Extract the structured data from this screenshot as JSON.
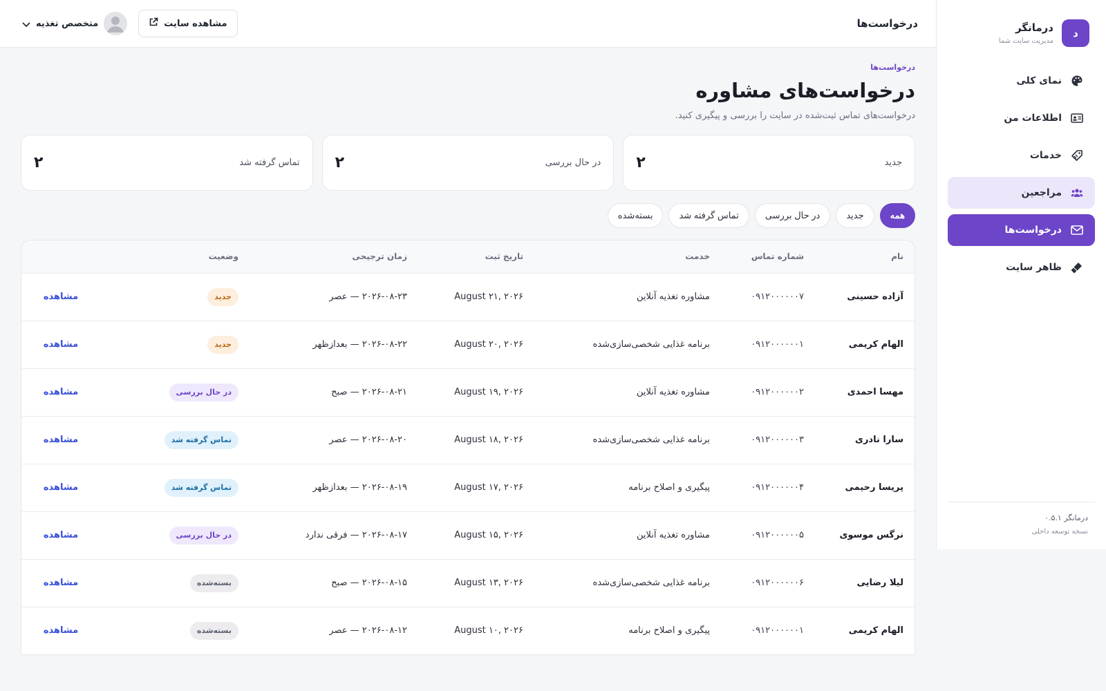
{
  "brand": {
    "logo_letter": "د",
    "name": "درمانگر",
    "subtitle": "مدیریت سایت شما"
  },
  "sidebar": {
    "items": [
      {
        "label": "نمای کلی",
        "icon": "palette-icon"
      },
      {
        "label": "اطلاعات من",
        "icon": "id-card-icon"
      },
      {
        "label": "خدمات",
        "icon": "tag-icon"
      },
      {
        "label": "مراجعین",
        "icon": "users-icon"
      },
      {
        "label": "درخواست‌ها",
        "icon": "envelope-icon"
      },
      {
        "label": "ظاهر سایت",
        "icon": "brush-icon"
      }
    ],
    "footer": {
      "version": "درمانگر ۰.۵.۱",
      "note": "نسخه توسعه داخلی"
    }
  },
  "topbar": {
    "title": "درخواست‌ها",
    "site_button": "مشاهده سایت",
    "user_name": "متخصص تغذیه"
  },
  "page": {
    "breadcrumb": "درخواست‌ها",
    "title": "درخواست‌های مشاوره",
    "description": "درخواست‌های تماس ثبت‌شده در سایت را بررسی و پیگیری کنید."
  },
  "stats": [
    {
      "label": "جدید",
      "value": "۲"
    },
    {
      "label": "در حال بررسی",
      "value": "۲"
    },
    {
      "label": "تماس گرفته شد",
      "value": "۲"
    }
  ],
  "filters": [
    "همه",
    "جدید",
    "در حال بررسی",
    "تماس گرفته شد",
    "بسته‌شده"
  ],
  "table": {
    "columns": [
      "نام",
      "شماره تماس",
      "خدمت",
      "تاریخ ثبت",
      "زمان ترجیحی",
      "وضعیت",
      ""
    ],
    "rows": [
      {
        "name": "آزاده حسینی",
        "phone": "۰۹۱۲۰۰۰۰۰۰۷",
        "service": "مشاوره تغذیه آنلاین",
        "date": "August ۲۱, ۲۰۲۶",
        "time": "۲۰۲۶-۰۸-۲۳ — عصر",
        "status": "جدید",
        "status_kind": "new",
        "action": "مشاهده"
      },
      {
        "name": "الهام کریمی",
        "phone": "۰۹۱۲۰۰۰۰۰۰۱",
        "service": "برنامه غذایی شخصی‌سازی‌شده",
        "date": "August ۲۰, ۲۰۲۶",
        "time": "۲۰۲۶-۰۸-۲۲ — بعدازظهر",
        "status": "جدید",
        "status_kind": "new",
        "action": "مشاهده"
      },
      {
        "name": "مهسا احمدی",
        "phone": "۰۹۱۲۰۰۰۰۰۰۲",
        "service": "مشاوره تغذیه آنلاین",
        "date": "August ۱۹, ۲۰۲۶",
        "time": "۲۰۲۶-۰۸-۲۱ — صبح",
        "status": "در حال بررسی",
        "status_kind": "review",
        "action": "مشاهده"
      },
      {
        "name": "سارا نادری",
        "phone": "۰۹۱۲۰۰۰۰۰۰۳",
        "service": "برنامه غذایی شخصی‌سازی‌شده",
        "date": "August ۱۸, ۲۰۲۶",
        "time": "۲۰۲۶-۰۸-۲۰ — عصر",
        "status": "تماس گرفته شد",
        "status_kind": "contacted",
        "action": "مشاهده"
      },
      {
        "name": "پریسا رحیمی",
        "phone": "۰۹۱۲۰۰۰۰۰۰۴",
        "service": "پیگیری و اصلاح برنامه",
        "date": "August ۱۷, ۲۰۲۶",
        "time": "۲۰۲۶-۰۸-۱۹ — بعدازظهر",
        "status": "تماس گرفته شد",
        "status_kind": "contacted",
        "action": "مشاهده"
      },
      {
        "name": "نرگس موسوی",
        "phone": "۰۹۱۲۰۰۰۰۰۰۵",
        "service": "مشاوره تغذیه آنلاین",
        "date": "August ۱۵, ۲۰۲۶",
        "time": "۲۰۲۶-۰۸-۱۷ — فرقی ندارد",
        "status": "در حال بررسی",
        "status_kind": "review",
        "action": "مشاهده"
      },
      {
        "name": "لیلا رضایی",
        "phone": "۰۹۱۲۰۰۰۰۰۰۶",
        "service": "برنامه غذایی شخصی‌سازی‌شده",
        "date": "August ۱۳, ۲۰۲۶",
        "time": "۲۰۲۶-۰۸-۱۵ — صبح",
        "status": "بسته‌شده",
        "status_kind": "closed",
        "action": "مشاهده"
      },
      {
        "name": "الهام کریمی",
        "phone": "۰۹۱۲۰۰۰۰۰۰۱",
        "service": "پیگیری و اصلاح برنامه",
        "date": "August ۱۰, ۲۰۲۶",
        "time": "۲۰۲۶-۰۸-۱۲ — عصر",
        "status": "بسته‌شده",
        "status_kind": "closed",
        "action": "مشاهده"
      }
    ]
  },
  "colors": {
    "accent": "#6c45c8",
    "accent_soft": "#ece6fb",
    "link": "#3a4fd8",
    "status_new": "#fdeedd",
    "status_review": "#efe8fc",
    "status_contacted": "#e0f1fb",
    "status_closed": "#ececef"
  }
}
